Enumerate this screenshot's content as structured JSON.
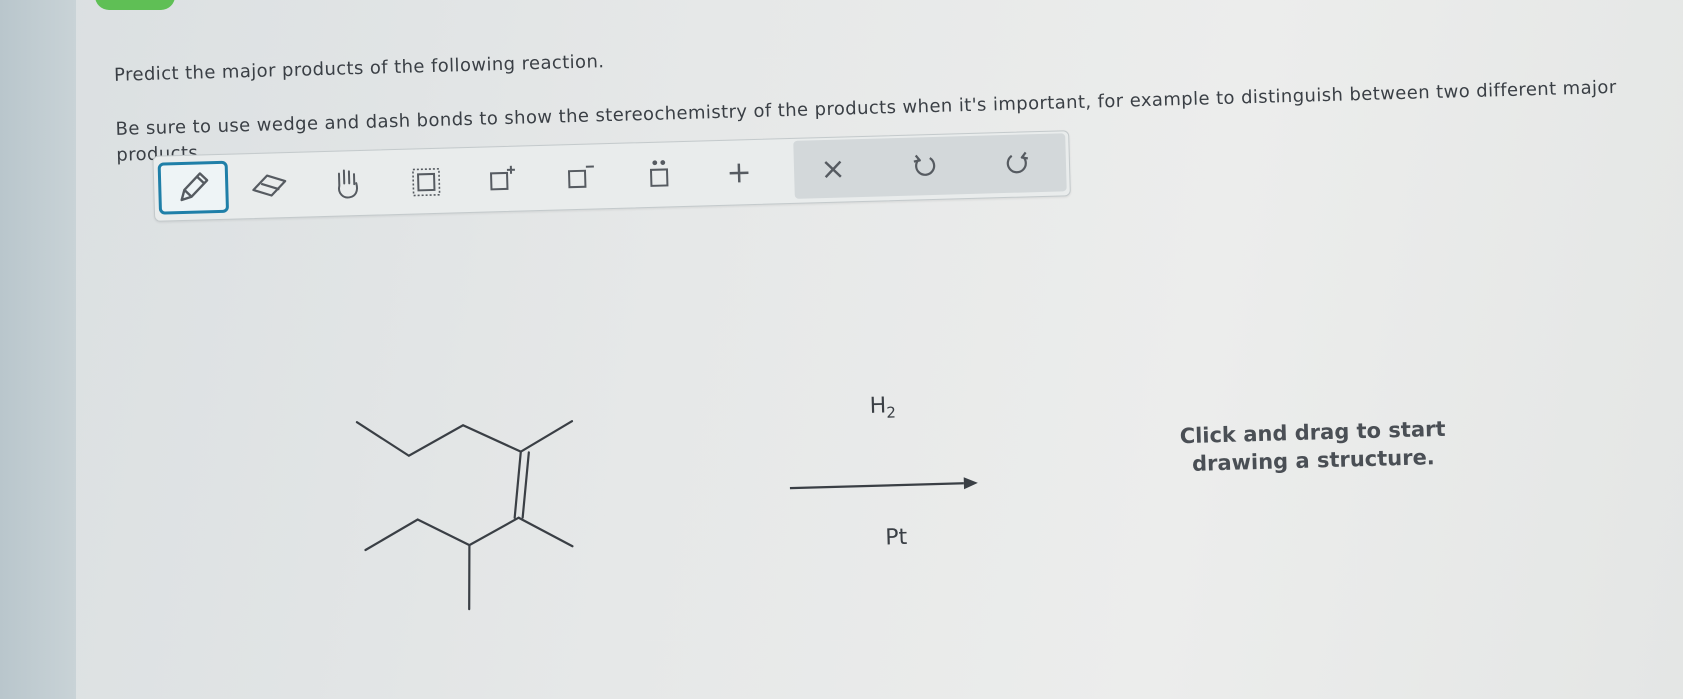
{
  "question": {
    "line1": "Predict the major products of the following reaction.",
    "line2": "Be sure to use wedge and dash bonds to show the stereochemistry of the products when it's important, for example to distinguish between two different major",
    "line3": "products."
  },
  "toolbar": {
    "tools": [
      {
        "name": "pencil-tool",
        "icon": "pencil-icon",
        "active": true
      },
      {
        "name": "eraser-tool",
        "icon": "eraser-icon",
        "active": false
      },
      {
        "name": "move-tool",
        "icon": "hand-icon",
        "active": false
      },
      {
        "name": "select-tool",
        "icon": "dashed-box-icon",
        "active": false
      },
      {
        "name": "positive-charge-tool",
        "icon": "box-plus-icon",
        "active": false
      },
      {
        "name": "negative-charge-tool",
        "icon": "box-minus-icon",
        "active": false
      },
      {
        "name": "lone-pair-tool",
        "icon": "box-dots-icon",
        "active": false
      }
    ],
    "add_label": "+",
    "clear_label": "×",
    "undo_icon": "undo-icon",
    "redo_icon": "redo-icon",
    "accent_color": "#1f7fa8"
  },
  "reaction": {
    "reagent_above_main": "H",
    "reagent_above_sub": "2",
    "reagent_below": "Pt"
  },
  "hint": {
    "line1": "Click and drag to start",
    "line2": "drawing a structure."
  }
}
